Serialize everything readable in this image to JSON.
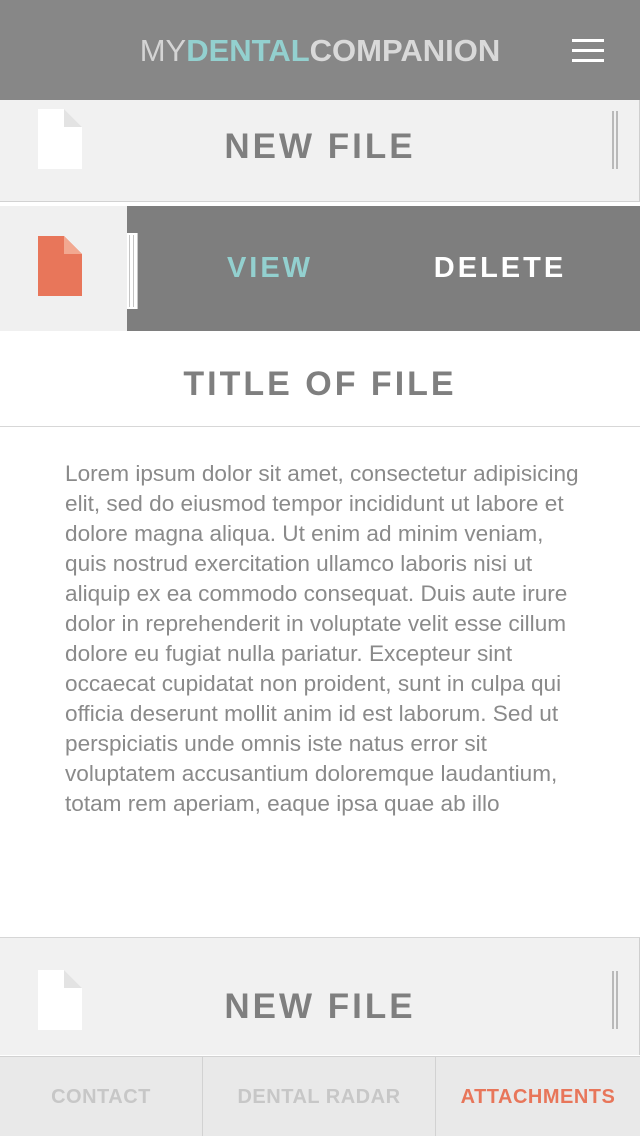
{
  "header": {
    "logo_prefix": "MY",
    "logo_highlight": "DENTAL",
    "logo_suffix": "COMPANION",
    "menu_icon": "hamburger-menu-icon"
  },
  "files": {
    "new_file_top_label": "NEW FILE",
    "new_file_bottom_label": "NEW FILE",
    "file_icon": "document-icon",
    "selected_file_icon_color": "#e8765a",
    "swipe_actions": {
      "view_label": "VIEW",
      "delete_label": "DELETE"
    }
  },
  "detail": {
    "title": "TITLE OF FILE",
    "body": "Lorem ipsum dolor sit amet, consectetur adipisicing elit, sed do eiusmod tempor incididunt ut labore et dolore magna aliqua. Ut enim ad minim veniam, quis nostrud exercitation ullamco laboris nisi ut aliquip ex ea commodo consequat. Duis aute irure dolor in reprehenderit in voluptate velit esse cillum dolore eu fugiat nulla pariatur. Excepteur sint occaecat cupidatat non proident, sunt in culpa qui officia deserunt mollit anim id est laborum. Sed ut perspiciatis unde omnis iste natus error sit voluptatem accusantium doloremque laudantium, totam rem aperiam, eaque ipsa quae ab illo"
  },
  "tabs": [
    {
      "label": "CONTACT",
      "active": false
    },
    {
      "label": "DENTAL RADAR",
      "active": false
    },
    {
      "label": "ATTACHMENTS",
      "active": true
    }
  ],
  "colors": {
    "header_bg": "#878787",
    "accent_teal": "#93d0cf",
    "accent_orange": "#e8765a"
  }
}
